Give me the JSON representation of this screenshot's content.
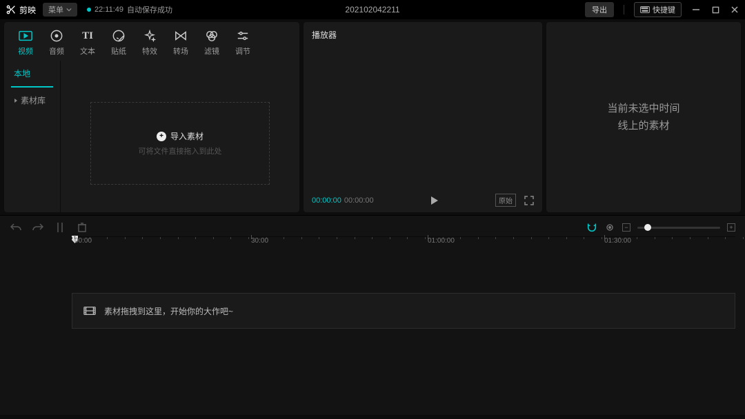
{
  "titlebar": {
    "app_name": "剪映",
    "menu_label": "菜单",
    "autosave_time": "22:11:49",
    "autosave_text": "自动保存成功",
    "project_name": "202102042211",
    "export_label": "导出",
    "shortcut_label": "快捷键"
  },
  "tool_tabs": [
    {
      "label": "视频"
    },
    {
      "label": "音频"
    },
    {
      "label": "文本"
    },
    {
      "label": "贴纸"
    },
    {
      "label": "特效"
    },
    {
      "label": "转场"
    },
    {
      "label": "滤镜"
    },
    {
      "label": "调节"
    }
  ],
  "side_tabs": {
    "local": "本地",
    "library": "素材库"
  },
  "dropzone": {
    "import_label": "导入素材",
    "hint": "可将文件直接拖入到此处"
  },
  "player": {
    "title": "播放器",
    "current_time": "00:00:00",
    "duration": "00:00:00",
    "ratio_label": "原始"
  },
  "props": {
    "empty_line1": "当前未选中时间",
    "empty_line2": "线上的素材"
  },
  "ruler": {
    "marks": [
      "00:00",
      "30:00",
      "01:00:00",
      "01:30:00"
    ]
  },
  "track_placeholder": "素材拖拽到这里，开始你的大作吧~"
}
